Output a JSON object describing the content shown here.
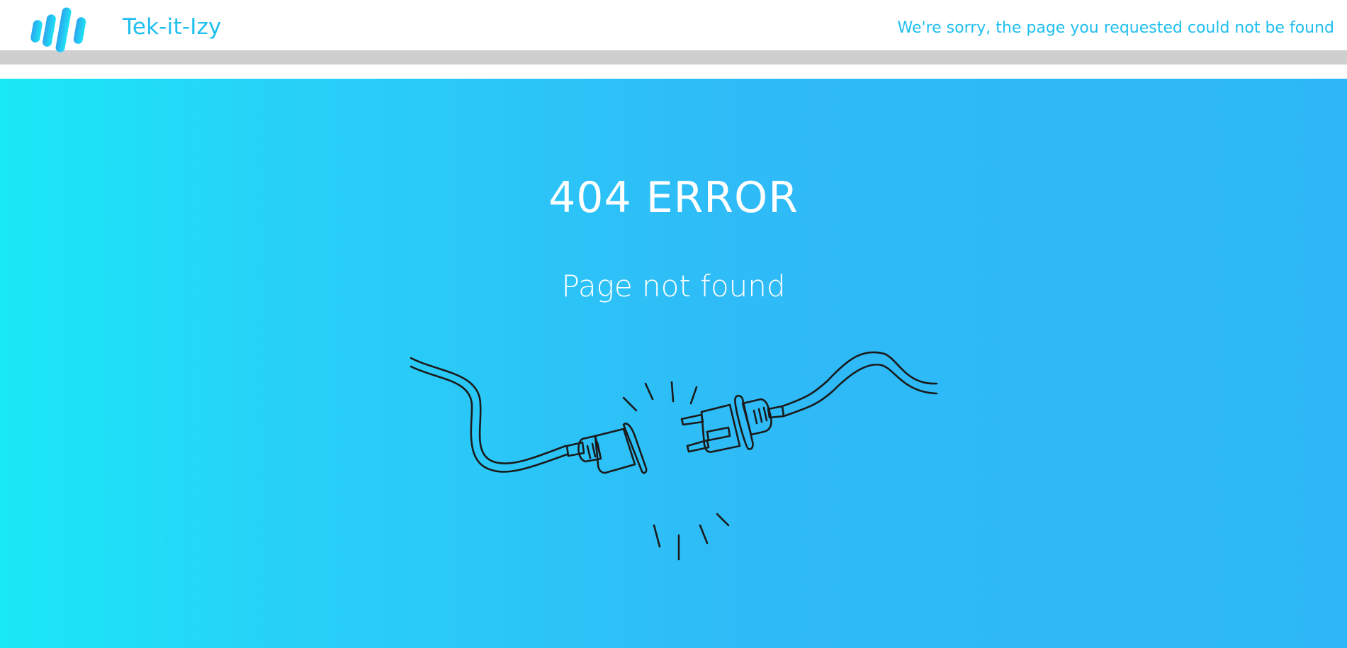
{
  "header": {
    "brand_name": "Tek-it-Izy",
    "logo_icon": "brand-bars-logo",
    "message": "We're sorry, the page you requested could not be found"
  },
  "main": {
    "title": "404 ERROR",
    "subtitle": "Page not found",
    "illustration_icon": "unplugged-cable-icon"
  },
  "colors": {
    "accent": "#1fbfee",
    "header_bg": "#ffffff",
    "divider": "#cfcfcf",
    "gradient_start": "#19e8f6",
    "gradient_end": "#2db7f6",
    "text_on_accent": "#ffffff",
    "line_art": "#1a1a1a"
  }
}
